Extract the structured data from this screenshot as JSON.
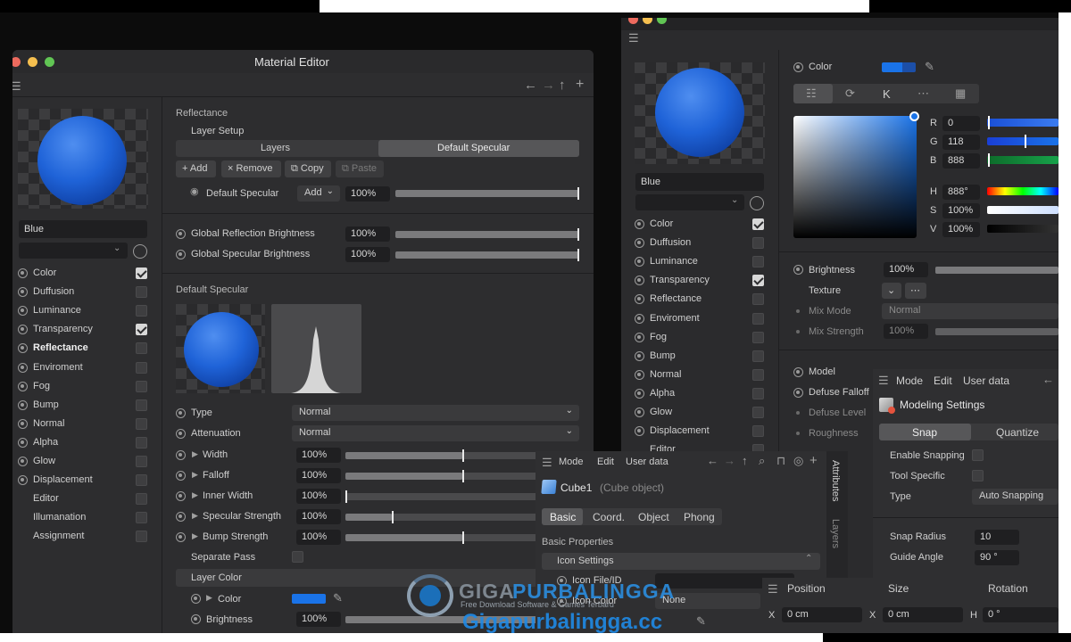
{
  "win1": {
    "title": "Material Editor",
    "preview_name": "Blue",
    "channels": [
      {
        "label": "Color",
        "checked": true,
        "bold": false
      },
      {
        "label": "Duffusion",
        "checked": false,
        "bold": false
      },
      {
        "label": "Luminance",
        "checked": false,
        "bold": false
      },
      {
        "label": "Transparency",
        "checked": true,
        "bold": false
      },
      {
        "label": "Reflectance",
        "checked": false,
        "bold": true
      },
      {
        "label": "Enviroment",
        "checked": false,
        "bold": false
      },
      {
        "label": "Fog",
        "checked": false,
        "bold": false
      },
      {
        "label": "Bump",
        "checked": false,
        "bold": false
      },
      {
        "label": "Normal",
        "checked": false,
        "bold": false
      },
      {
        "label": "Alpha",
        "checked": false,
        "bold": false
      },
      {
        "label": "Glow",
        "checked": false,
        "bold": false
      },
      {
        "label": "Displacement",
        "checked": false,
        "bold": false
      },
      {
        "label": "Editor",
        "checked": false,
        "bold": false,
        "noradio": true
      },
      {
        "label": "Illumanation",
        "checked": false,
        "bold": false,
        "noradio": true
      },
      {
        "label": "Assignment",
        "checked": false,
        "bold": false,
        "noradio": true
      }
    ],
    "reflectance": {
      "header": "Reflectance",
      "layer_setup": "Layer Setup",
      "tab_layers": "Layers",
      "tab_default": "Default Specular",
      "btn_add": "+ Add",
      "btn_remove": "× Remove",
      "btn_copy": "⧉ Copy",
      "btn_paste": "⧉ Paste",
      "layer_name": "Default Specular",
      "layer_mode": "Add",
      "layer_value": "100%",
      "gref_label": "Global Reflection Brightness",
      "gref_value": "100%",
      "gspec_label": "Global Specular Brightness",
      "gspec_value": "100%",
      "ds_header": "Default Specular",
      "type_label": "Type",
      "type_value": "Normal",
      "att_label": "Attenuation",
      "att_value": "Normal",
      "rows": [
        {
          "label": "Width",
          "value": "100%",
          "level": 0.5
        },
        {
          "label": "Falloff",
          "value": "100%",
          "level": 0.5
        },
        {
          "label": "Inner Width",
          "value": "100%",
          "level": 0.0
        },
        {
          "label": "Specular Strength",
          "value": "100%",
          "level": 0.2
        },
        {
          "label": "Bump Strength",
          "value": "100%",
          "level": 0.5
        }
      ],
      "sep_pass": "Separate Pass",
      "layer_color": "Layer Color",
      "color_label": "Color",
      "bright_label": "Brightness",
      "bright_value": "100%"
    }
  },
  "win2": {
    "preview_name": "Blue",
    "channels": [
      {
        "label": "Color",
        "checked": true
      },
      {
        "label": "Duffusion",
        "checked": false
      },
      {
        "label": "Luminance",
        "checked": false
      },
      {
        "label": "Transparency",
        "checked": true
      },
      {
        "label": "Reflectance",
        "checked": false
      },
      {
        "label": "Enviroment",
        "checked": false
      },
      {
        "label": "Fog",
        "checked": false
      },
      {
        "label": "Bump",
        "checked": false
      },
      {
        "label": "Normal",
        "checked": false
      },
      {
        "label": "Alpha",
        "checked": false
      },
      {
        "label": "Glow",
        "checked": false
      },
      {
        "label": "Displacement",
        "checked": false
      },
      {
        "label": "Editor",
        "checked": false,
        "noradio": true
      }
    ],
    "color_label": "Color",
    "tab_k": "K",
    "rgb": [
      {
        "l": "R",
        "v": "0"
      },
      {
        "l": "G",
        "v": "118"
      },
      {
        "l": "B",
        "v": "888"
      }
    ],
    "hsv": [
      {
        "l": "H",
        "v": "888°"
      },
      {
        "l": "S",
        "v": "100%"
      },
      {
        "l": "V",
        "v": "100%"
      }
    ],
    "brightness_label": "Brightness",
    "brightness_value": "100%",
    "texture_label": "Texture",
    "mixmode_label": "Mix Mode",
    "mixmode_value": "Normal",
    "mixstr_label": "Mix Strength",
    "mixstr_value": "100%",
    "model_label": "Model",
    "defuse_falloff": "Defuse Falloff",
    "defuse_level": "Defuse Level",
    "roughness": "Roughness"
  },
  "attr": {
    "menu": [
      "Mode",
      "Edit",
      "User data"
    ],
    "object_name": "Cube1",
    "object_type": "(Cube object)",
    "tabs": [
      "Basic",
      "Coord.",
      "Object",
      "Phong"
    ],
    "section": "Basic Properties",
    "icon_settings": "Icon Settings",
    "icon_file": "Icon File/ID",
    "icon_color": "Icon Color",
    "icon_color_value": "None",
    "side_tab1": "Attributes",
    "side_tab2": "Layers"
  },
  "modeling": {
    "menu": [
      "Mode",
      "Edit",
      "User data"
    ],
    "title": "Modeling Settings",
    "tab_snap": "Snap",
    "tab_quantize": "Quantize",
    "enable_snapping": "Enable Snapping",
    "tool_specific": "Tool Specific",
    "type_label": "Type",
    "type_value": "Auto Snapping",
    "snap_radius": "Snap Radius",
    "snap_radius_value": "10",
    "guide_angle": "Guide Angle",
    "guide_angle_value": "90 °"
  },
  "coords": {
    "position": "Position",
    "size": "Size",
    "rotation": "Rotation",
    "x_label": "X",
    "x_value": "0 cm",
    "sx_label": "X",
    "sx_value": "0 cm",
    "h_label": "H",
    "h_value": "0 °"
  },
  "watermark": {
    "brand_a": "GIGA",
    "brand_b": "PURBALINGGA",
    "tagline": "Free Download Software & Games Terbaru",
    "url": "Gigapurbalingga.cc"
  },
  "colors": {
    "accent": "#1a73e8",
    "panel": "#2d2d2f",
    "field": "#1f1f21"
  }
}
